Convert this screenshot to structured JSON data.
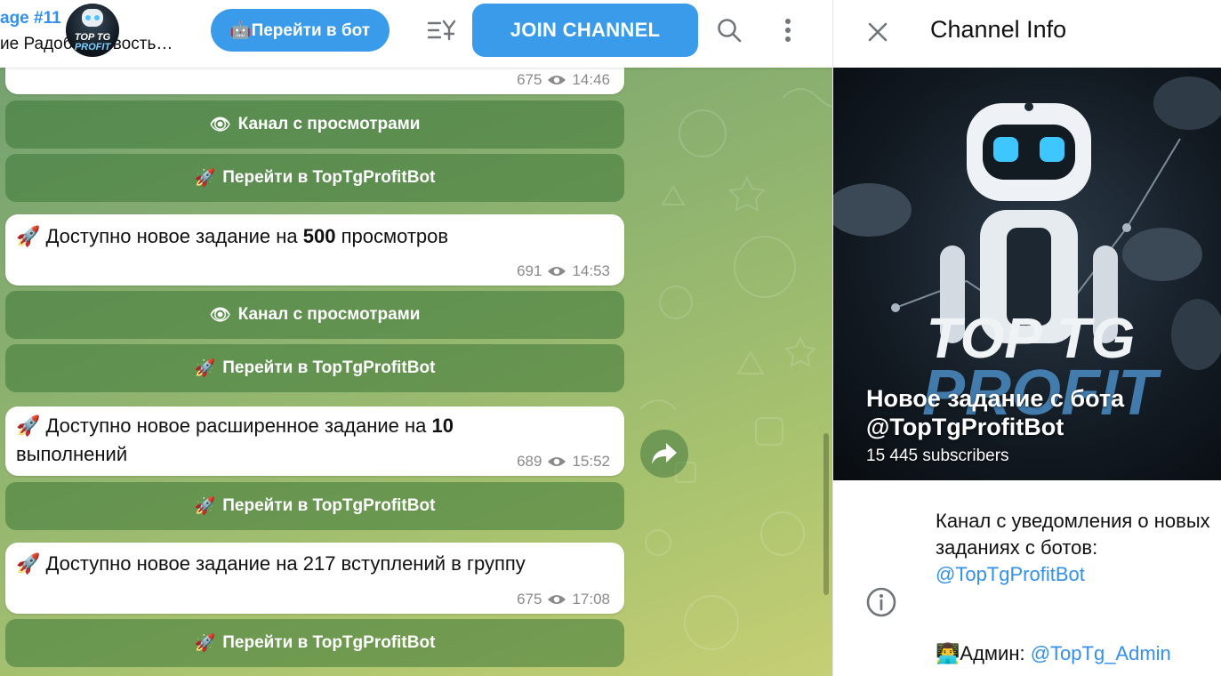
{
  "header": {
    "title": "age #11",
    "subtitle": "ие Радобот новость…",
    "avatar_text_1": "TOP TG",
    "avatar_text_2": "PROFIT",
    "bot_button_label": "🤖Перейти в бот",
    "join_label": "JOIN CHANNEL"
  },
  "messages": [
    {
      "views": "675",
      "time": "14:46",
      "buttons": [
        {
          "emoji": "👁",
          "label": "Канал с просмотрами"
        },
        {
          "emoji": "🚀",
          "label": "Перейти в TopTgProfitBot"
        }
      ]
    },
    {
      "emoji": "🚀",
      "text_before": "Доступно новое задание на",
      "text_bold": "500",
      "text_after": "просмотров",
      "views": "691",
      "time": "14:53",
      "buttons": [
        {
          "emoji": "👁",
          "label": "Канал с просмотрами"
        },
        {
          "emoji": "🚀",
          "label": "Перейти в TopTgProfitBot"
        }
      ]
    },
    {
      "emoji": "🚀",
      "text_before": "Доступно новое расширенное задание на",
      "text_bold": "10",
      "text_after": "выполнений",
      "views": "689",
      "time": "15:52",
      "buttons": [
        {
          "emoji": "🚀",
          "label": "Перейти в TopTgProfitBot"
        }
      ]
    },
    {
      "emoji": "🚀",
      "text_before": "Доступно новое задание на 217 вступлений в группу",
      "views": "675",
      "time": "17:08",
      "buttons": [
        {
          "emoji": "🚀",
          "label": "Перейти в TopTgProfitBot"
        }
      ]
    }
  ],
  "panel": {
    "title": "Channel Info",
    "cover_text_1": "TOP TG",
    "cover_text_2": "PROFIT",
    "channel_name": "Новое задание с бота @TopTgProfitBot",
    "subscribers": "15 445 subscribers",
    "description": "Канал с уведомления о новых заданиях с ботов:",
    "description_link": "@TopTgProfitBot",
    "admin_emoji": "👨‍💻",
    "admin_label": "Админ:",
    "admin_link": "@TopTg_Admin"
  },
  "colors": {
    "accent": "#3390ec",
    "button_blue": "#3a9bea",
    "chat_green": "#8fb36f"
  },
  "icons": {
    "filter": "filter-icon",
    "search": "search-icon",
    "more": "more-vertical-icon",
    "forward": "forward-icon",
    "close": "close-icon",
    "info": "info-icon",
    "views": "eye-icon"
  }
}
